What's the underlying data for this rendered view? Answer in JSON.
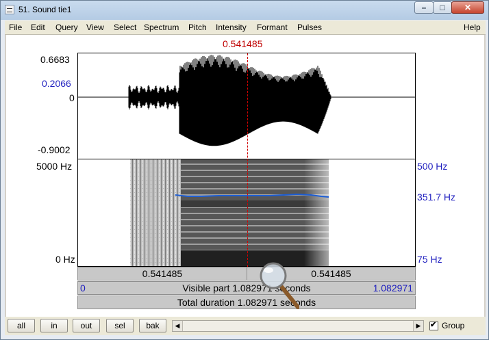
{
  "window": {
    "title": "51. Sound tie1",
    "minimize_glyph": "–",
    "maximize_glyph": "□",
    "close_glyph": "✕"
  },
  "menu": {
    "items": [
      "File",
      "Edit",
      "Query",
      "View",
      "Select",
      "Spectrum",
      "Pitch",
      "Intensity",
      "Formant",
      "Pulses"
    ],
    "help": "Help"
  },
  "cursor": {
    "time_label": "0.541485"
  },
  "waveform": {
    "max_label": "0.6683",
    "cursor_value_label": "0.2066",
    "zero_label": "0",
    "min_label": "-0.9002"
  },
  "spectrogram": {
    "top_label": "5000 Hz",
    "bottom_label": "0 Hz"
  },
  "pitch": {
    "top_label": "500 Hz",
    "value_label": "351.7 Hz",
    "bottom_label": "75 Hz"
  },
  "selection": {
    "left_label": "0.541485",
    "right_label": "0.541485"
  },
  "visible": {
    "start": "0",
    "text": "Visible part 1.082971 seconds",
    "end": "1.082971"
  },
  "total": {
    "text": "Total duration 1.082971 seconds"
  },
  "controls": {
    "buttons": [
      "all",
      "in",
      "out",
      "sel",
      "bak"
    ],
    "scroll_left": "◀",
    "scroll_right": "▶",
    "group_label": "Group",
    "group_checked": "✔"
  },
  "colors": {
    "cursor": "#c00000",
    "pitch_line": "#1e5fd6",
    "axis_blue": "#1f1fbf"
  }
}
